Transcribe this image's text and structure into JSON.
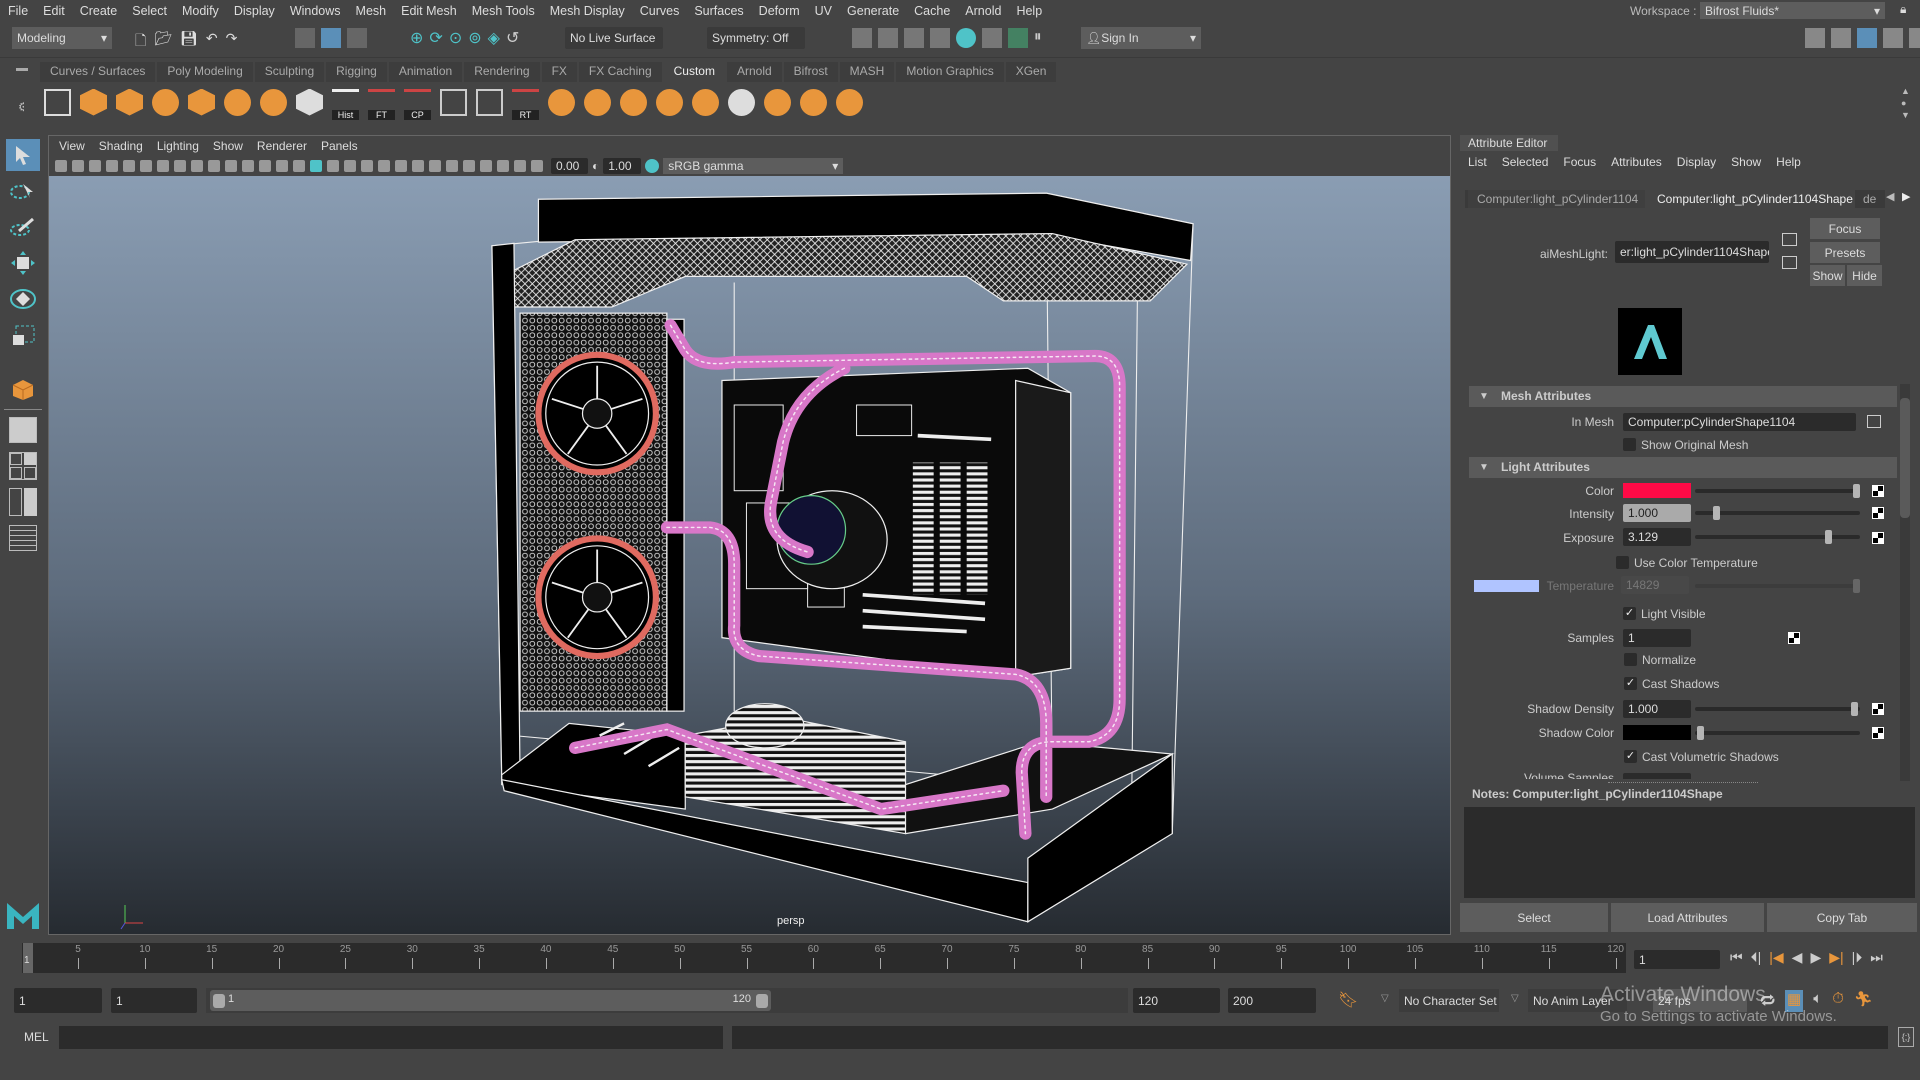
{
  "menubar": [
    "File",
    "Edit",
    "Create",
    "Select",
    "Modify",
    "Display",
    "Windows",
    "Mesh",
    "Edit Mesh",
    "Mesh Tools",
    "Mesh Display",
    "Curves",
    "Surfaces",
    "Deform",
    "UV",
    "Generate",
    "Cache",
    "Arnold",
    "Help"
  ],
  "workspace": {
    "label": "Workspace :",
    "value": "Bifrost Fluids*"
  },
  "status": {
    "mode": "Modeling",
    "live_surface": "No Live Surface",
    "symmetry": "Symmetry: Off",
    "sign_in": "Sign In"
  },
  "shelf_tabs": [
    "Curves / Surfaces",
    "Poly Modeling",
    "Sculpting",
    "Rigging",
    "Animation",
    "Rendering",
    "FX",
    "FX Caching",
    "Custom",
    "Arnold",
    "Bifrost",
    "MASH",
    "Motion Graphics",
    "XGen"
  ],
  "shelf_active": "Custom",
  "shelf_labels": {
    "hist": "Hist",
    "ft": "FT",
    "cp": "CP",
    "rt": "RT"
  },
  "viewport": {
    "menu": [
      "View",
      "Shading",
      "Lighting",
      "Show",
      "Renderer",
      "Panels"
    ],
    "exposure": "0.00",
    "gamma": "1.00",
    "color_space": "sRGB gamma",
    "camera": "persp"
  },
  "attribute_editor": {
    "title": "Attribute Editor",
    "menu": [
      "List",
      "Selected",
      "Focus",
      "Attributes",
      "Display",
      "Show",
      "Help"
    ],
    "node_tabs": [
      "Computer:light_pCylinder1104",
      "Computer:light_pCylinder1104Shape",
      "de"
    ],
    "node_label": "aiMeshLight:",
    "node_value": "er:light_pCylinder1104Shape",
    "buttons": {
      "focus": "Focus",
      "presets": "Presets",
      "show": "Show",
      "hide": "Hide"
    },
    "mesh_section": "Mesh Attributes",
    "in_mesh_label": "In Mesh",
    "in_mesh_value": "Computer:pCylinderShape1104",
    "show_original_mesh": {
      "label": "Show Original Mesh",
      "checked": false
    },
    "light_section": "Light Attributes",
    "color": {
      "label": "Color",
      "value": "#ff0a46"
    },
    "intensity": {
      "label": "Intensity",
      "value": "1.000"
    },
    "exposure": {
      "label": "Exposure",
      "value": "3.129"
    },
    "use_color_temperature": {
      "label": "Use Color Temperature",
      "checked": false
    },
    "temperature": {
      "label": "Temperature",
      "value": "14829",
      "swatch": "#b0c4ff"
    },
    "light_visible": {
      "label": "Light Visible",
      "checked": true
    },
    "samples": {
      "label": "Samples",
      "value": "1"
    },
    "normalize": {
      "label": "Normalize",
      "checked": false
    },
    "cast_shadows": {
      "label": "Cast Shadows",
      "checked": true
    },
    "shadow_density": {
      "label": "Shadow Density",
      "value": "1.000"
    },
    "shadow_color": {
      "label": "Shadow Color",
      "value": "#000000"
    },
    "cast_volumetric_shadows": {
      "label": "Cast Volumetric Shadows",
      "checked": true
    },
    "volume_samples": {
      "label": "Volume Samples"
    },
    "notes_label": "Notes:  Computer:light_pCylinder1104Shape",
    "bottom_buttons": [
      "Select",
      "Load Attributes",
      "Copy Tab"
    ]
  },
  "timeline": {
    "ticks": [
      5,
      10,
      15,
      20,
      25,
      30,
      35,
      40,
      45,
      50,
      55,
      60,
      65,
      70,
      75,
      80,
      85,
      90,
      95,
      100,
      105,
      110,
      115,
      120
    ],
    "current_frame": "1",
    "current_field": "1"
  },
  "range": {
    "start": "1",
    "playback_start": "1",
    "range_start": "1",
    "range_end": "120",
    "playback_end": "120",
    "end": "200",
    "character_set": "No Character Set",
    "anim_layer": "No Anim Layer",
    "fps": "24 fps"
  },
  "command": {
    "language": "MEL"
  },
  "watermark": {
    "line1": "Activate Windows",
    "line2": "Go to Settings to activate Windows."
  },
  "accent": {
    "orange": "#e8963c",
    "teal": "#4fc3c8",
    "pipe": "#d877c8",
    "fan_ring": "#e06a60"
  }
}
